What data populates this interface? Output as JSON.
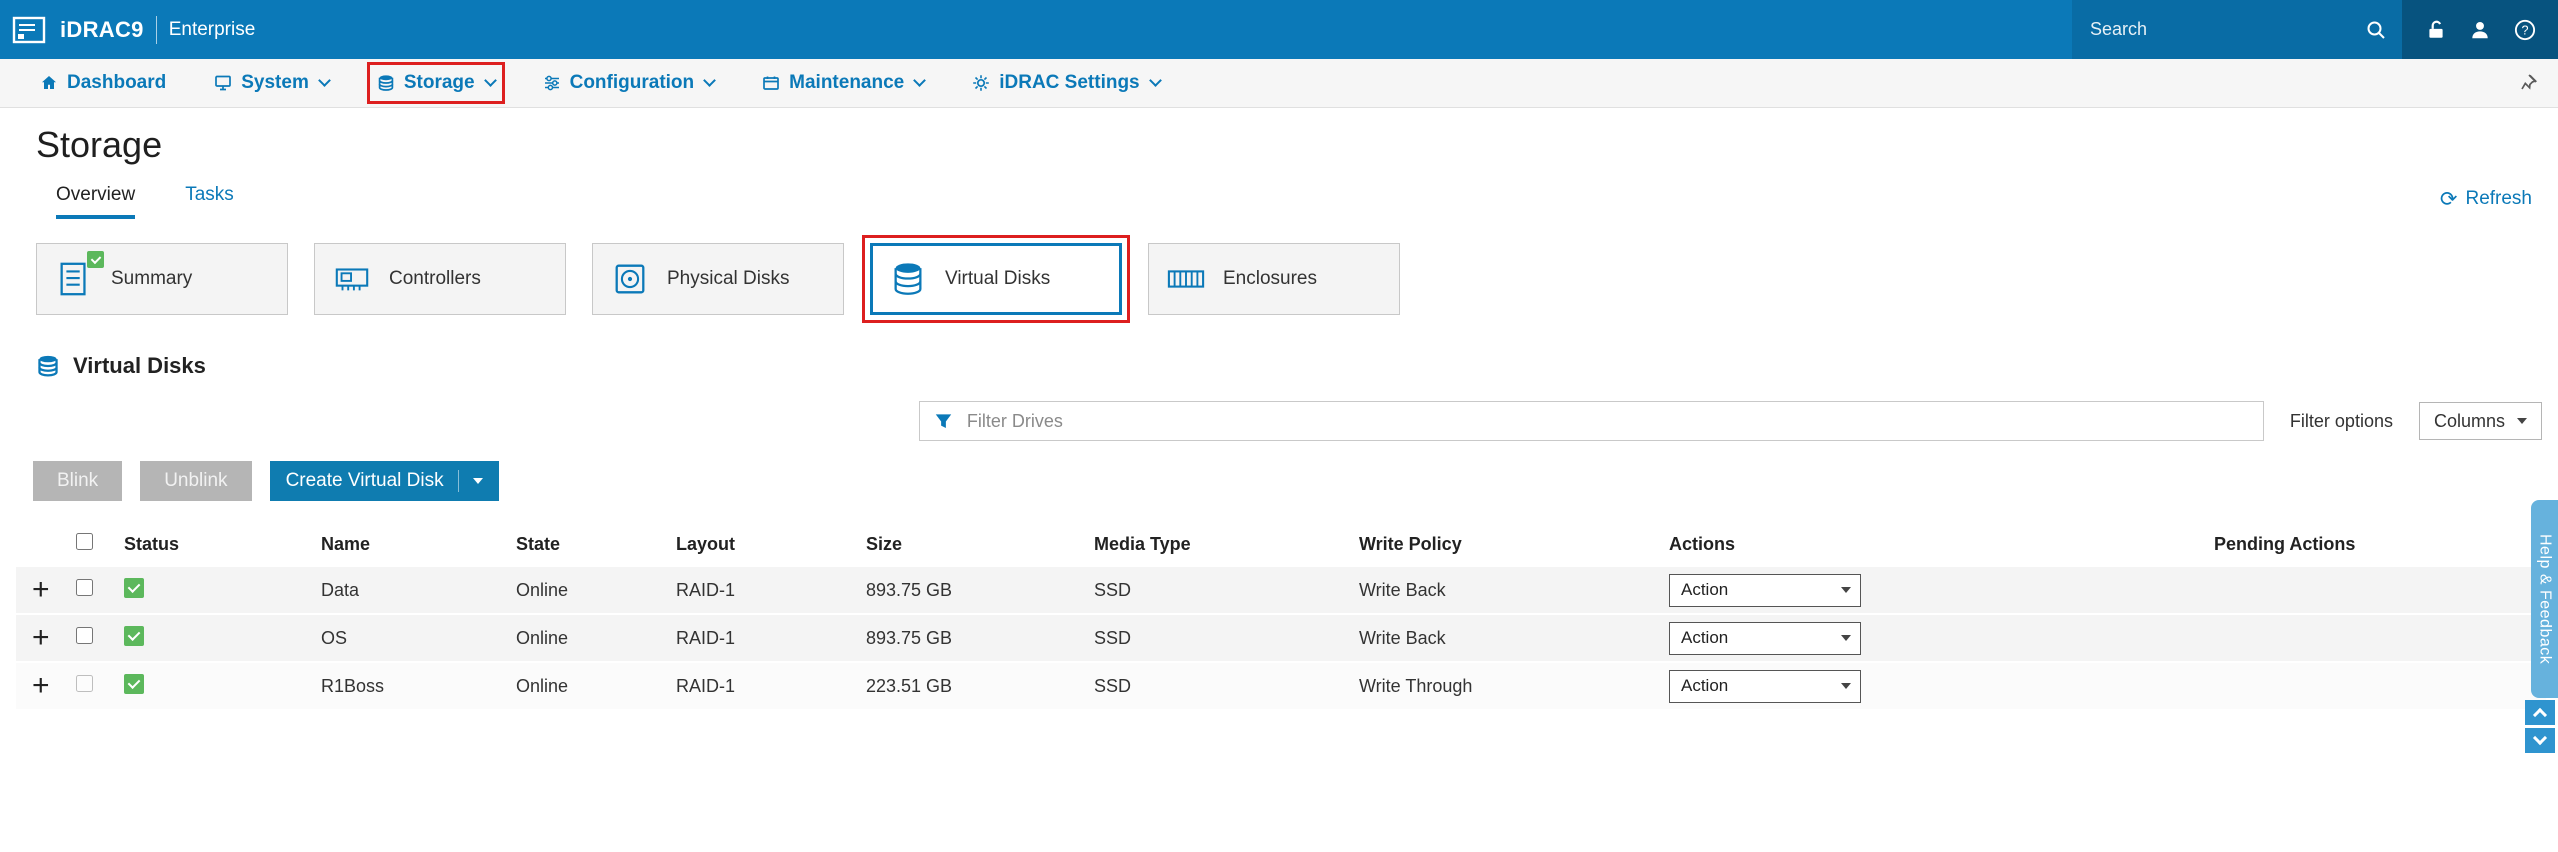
{
  "masthead": {
    "product": "iDRAC9",
    "edition": "Enterprise",
    "search_placeholder": "Search"
  },
  "nav": {
    "items": [
      {
        "label": "Dashboard"
      },
      {
        "label": "System"
      },
      {
        "label": "Storage"
      },
      {
        "label": "Configuration"
      },
      {
        "label": "Maintenance"
      },
      {
        "label": "iDRAC Settings"
      }
    ]
  },
  "page": {
    "title": "Storage",
    "tabs": [
      {
        "label": "Overview"
      },
      {
        "label": "Tasks"
      }
    ],
    "refresh_label": "Refresh"
  },
  "cards": {
    "items": [
      {
        "label": "Summary"
      },
      {
        "label": "Controllers"
      },
      {
        "label": "Physical Disks"
      },
      {
        "label": "Virtual Disks"
      },
      {
        "label": "Enclosures"
      }
    ]
  },
  "section": {
    "title": "Virtual Disks"
  },
  "filter": {
    "placeholder": "Filter Drives",
    "options_label": "Filter options",
    "columns_label": "Columns"
  },
  "toolbar": {
    "blink_label": "Blink",
    "unblink_label": "Unblink",
    "create_label": "Create Virtual Disk"
  },
  "table": {
    "headers": [
      "Status",
      "Name",
      "State",
      "Layout",
      "Size",
      "Media Type",
      "Write Policy",
      "Actions",
      "Pending Actions"
    ],
    "rows": [
      {
        "name": "Data",
        "state": "Online",
        "layout": "RAID-1",
        "size": "893.75 GB",
        "media_type": "SSD",
        "write_policy": "Write Back",
        "action": "Action",
        "pending": ""
      },
      {
        "name": "OS",
        "state": "Online",
        "layout": "RAID-1",
        "size": "893.75 GB",
        "media_type": "SSD",
        "write_policy": "Write Back",
        "action": "Action",
        "pending": ""
      },
      {
        "name": "R1Boss",
        "state": "Online",
        "layout": "RAID-1",
        "size": "223.51 GB",
        "media_type": "SSD",
        "write_policy": "Write Through",
        "action": "Action",
        "pending": ""
      }
    ]
  },
  "side": {
    "help_feedback_label": "Help & Feedback"
  },
  "annotations": {
    "highlighted": [
      "storage-nav-item",
      "virtual-disks-card"
    ],
    "color": "#dd1f1f"
  },
  "colors": {
    "brand_blue": "#0b79b8",
    "masthead_icons_bg": "#07537f",
    "status_green": "#5cb85c",
    "annotation_red": "#dd1f1f",
    "disabled_gray": "#b5b5b5",
    "help_tab_blue": "#66b2dd"
  }
}
